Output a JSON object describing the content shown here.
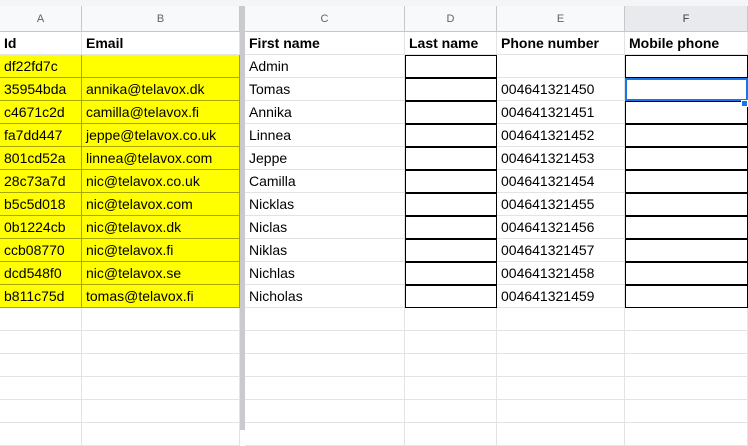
{
  "column_letters": [
    "A",
    "B",
    "C",
    "D",
    "E",
    "F"
  ],
  "headers": [
    "Id",
    "Email",
    "First name",
    "Last name",
    "Phone number",
    "Mobile phone"
  ],
  "rows": [
    {
      "id": "df22fd7c",
      "email": "",
      "first": "Admin",
      "last": "",
      "phone": "",
      "mobile": ""
    },
    {
      "id": "35954bda",
      "email": "annika@telavox.dk",
      "first": "Tomas",
      "last": "",
      "phone": "004641321450",
      "mobile": ""
    },
    {
      "id": "c4671c2d",
      "email": "camilla@telavox.fi",
      "first": "Annika",
      "last": "",
      "phone": "004641321451",
      "mobile": ""
    },
    {
      "id": "fa7dd447",
      "email": "jeppe@telavox.co.uk",
      "first": "Linnea",
      "last": "",
      "phone": "004641321452",
      "mobile": ""
    },
    {
      "id": "801cd52a",
      "email": "linnea@telavox.com",
      "first": "Jeppe",
      "last": "",
      "phone": "004641321453",
      "mobile": ""
    },
    {
      "id": "28c73a7d",
      "email": "nic@telavox.co.uk",
      "first": "Camilla",
      "last": "",
      "phone": "004641321454",
      "mobile": ""
    },
    {
      "id": "b5c5d018",
      "email": "nic@telavox.com",
      "first": "Nicklas",
      "last": "",
      "phone": "004641321455",
      "mobile": ""
    },
    {
      "id": "0b1224cb",
      "email": "nic@telavox.dk",
      "first": "Niclas",
      "last": "",
      "phone": "004641321456",
      "mobile": ""
    },
    {
      "id": "ccb08770",
      "email": "nic@telavox.fi",
      "first": "Niklas",
      "last": "",
      "phone": "004641321457",
      "mobile": ""
    },
    {
      "id": "dcd548f0",
      "email": "nic@telavox.se",
      "first": "Nichlas",
      "last": "",
      "phone": "004641321458",
      "mobile": ""
    },
    {
      "id": "b811c75d",
      "email": "tomas@telavox.fi",
      "first": "Nicholas",
      "last": "",
      "phone": "004641321459",
      "mobile": ""
    }
  ],
  "empty_rows": 6,
  "highlight_color": "#ffff00",
  "selection_color": "#1a73e8",
  "active_cell": "F3"
}
